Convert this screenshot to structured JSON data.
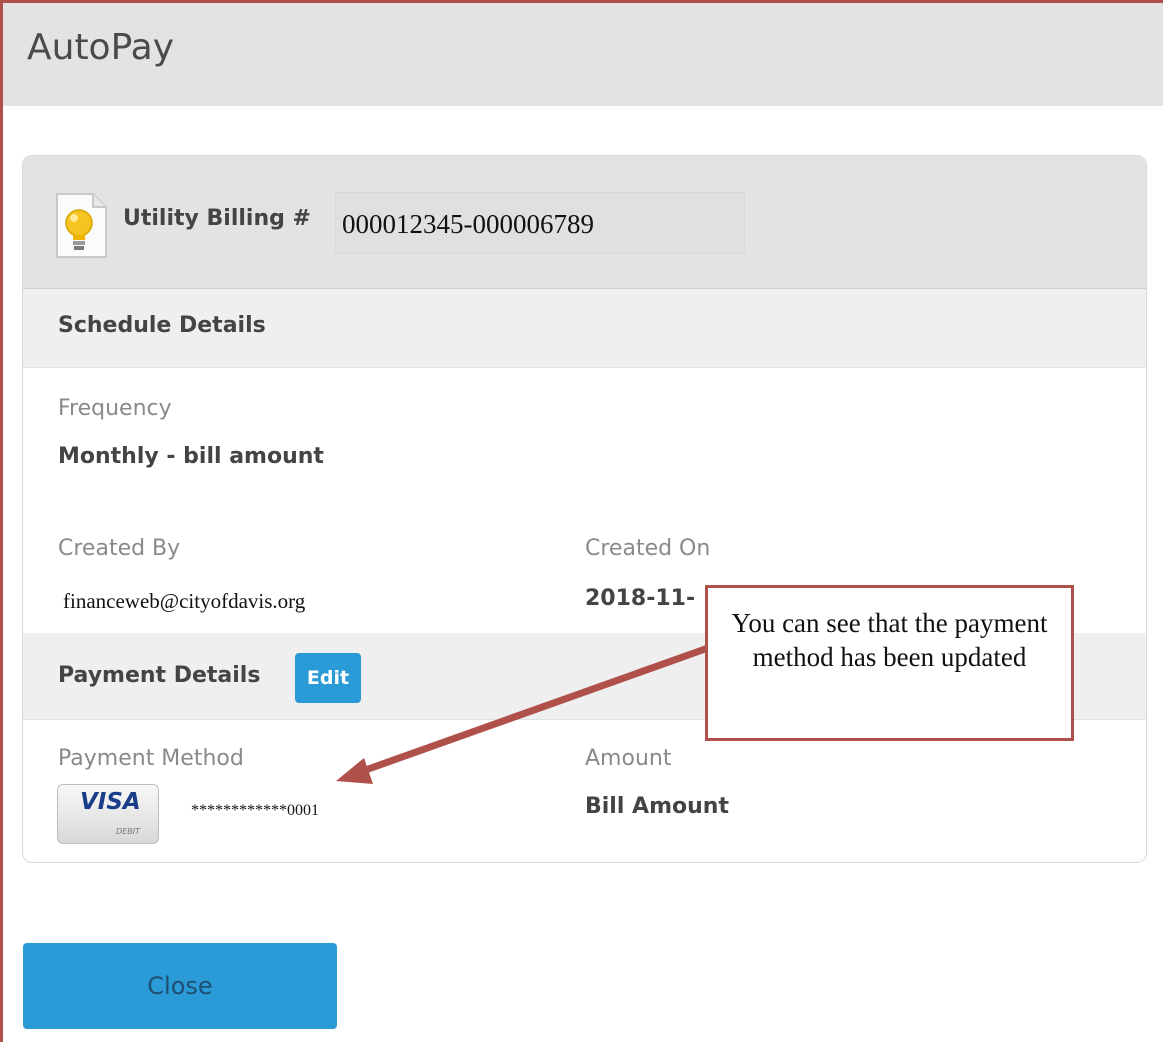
{
  "window": {
    "title": "AutoPay"
  },
  "billing": {
    "label": "Utility Billing #",
    "value": "000012345-000006789"
  },
  "schedule": {
    "section_title": "Schedule Details",
    "frequency_label": "Frequency",
    "frequency_value": "Monthly - bill amount",
    "created_by_label": "Created By",
    "created_by_value": "financeweb@cityofdavis.org",
    "created_on_label": "Created On",
    "created_on_value": "2018-11-"
  },
  "payment": {
    "section_title": "Payment Details",
    "edit_label": "Edit",
    "method_label": "Payment Method",
    "card_brand": "VISA",
    "card_type": "DEBIT",
    "card_number": "************0001",
    "amount_label": "Amount",
    "amount_value": "Bill Amount"
  },
  "footer": {
    "close_label": "Close"
  },
  "annotation": {
    "callout_text": "You can see that the payment method has been updated"
  },
  "icons": {
    "billing_icon": "lightbulb-document-icon",
    "card_icon": "visa-card-icon",
    "arrow": "callout-arrow"
  },
  "colors": {
    "accent": "#2a9bd6",
    "frame": "#b0504a",
    "header_bg": "#e3e3e3"
  }
}
